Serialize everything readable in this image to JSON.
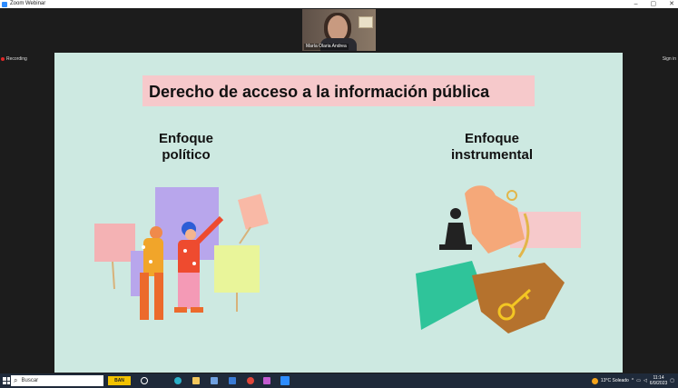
{
  "window": {
    "title": "Zoom Webinar",
    "controls": [
      "–",
      "▢",
      "✕"
    ]
  },
  "participant": {
    "name": "María Olaria Andrea"
  },
  "recording": {
    "label": "Recording"
  },
  "signin": {
    "label": "Sign in"
  },
  "slide": {
    "title": "Derecho de acceso a la información pública",
    "left_heading": "Enfoque político",
    "right_heading": "Enfoque instrumental"
  },
  "taskbar": {
    "search_placeholder": "Buscar",
    "badge_text": "BAN",
    "weather": "13°C  Soleado",
    "time": "11:14",
    "date": "6/9/2023"
  }
}
